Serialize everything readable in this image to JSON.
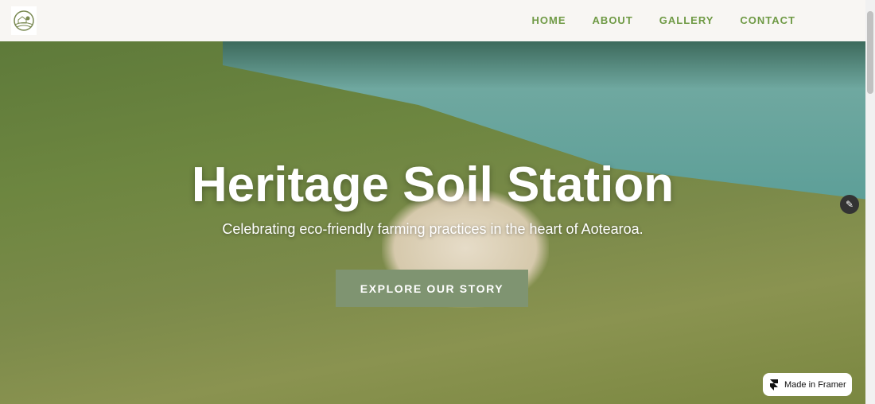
{
  "nav": {
    "links": [
      "HOME",
      "ABOUT",
      "GALLERY",
      "CONTACT"
    ]
  },
  "hero": {
    "title": "Heritage Soil Station",
    "subtitle": "Celebrating eco-friendly farming practices in the heart of Aotearoa.",
    "cta": "EXPLORE OUR STORY"
  },
  "badge": {
    "label": "Made in Framer"
  },
  "colors": {
    "nav_link": "#6f9a45",
    "cta": "#7f9471"
  }
}
